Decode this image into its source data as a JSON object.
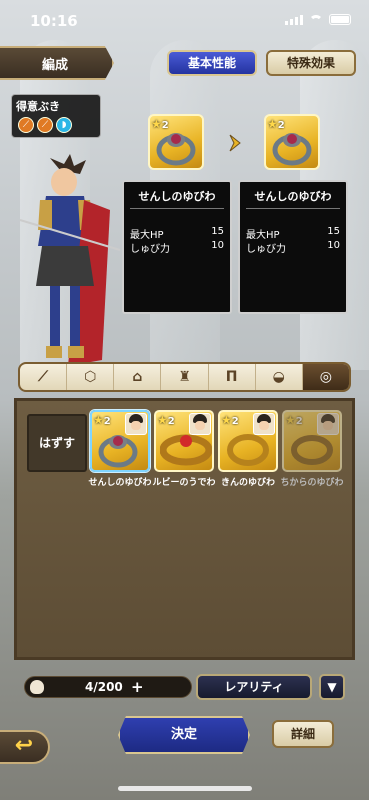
{
  "status_bar": {
    "time": "10:16"
  },
  "header": {
    "tab_label": "編成",
    "basic_label": "基本性能",
    "special_label": "特殊効果"
  },
  "weapon_panel": {
    "label": "得意ぶき"
  },
  "current": {
    "rarity": "2",
    "name": "せんしのゆびわ",
    "stat1_label": "最大HP",
    "stat1_value": "15",
    "stat2_label": "しゅび力",
    "stat2_value": "10"
  },
  "new": {
    "rarity": "2",
    "name": "せんしのゆびわ",
    "stat1_label": "最大HP",
    "stat1_value": "15",
    "stat2_label": "しゅび力",
    "stat2_value": "10"
  },
  "inventory": {
    "unequip_label": "はずす",
    "items": [
      {
        "rarity": "2",
        "name": "せんしのゆびわ"
      },
      {
        "rarity": "2",
        "name": "ルビーのうでわ"
      },
      {
        "rarity": "2",
        "name": "きんのゆびわ"
      },
      {
        "rarity": "2",
        "name": "ちからのゆびわ"
      }
    ]
  },
  "footer": {
    "count": "4/200",
    "plus": "+",
    "rarity_label": "レアリティ",
    "sort_icon": "▼",
    "confirm_label": "決定",
    "detail_label": "詳細",
    "back_icon": "↩"
  },
  "icons": [
    "sword-icon",
    "shield-icon",
    "helmet-icon",
    "armor-icon",
    "pants-icon",
    "accessory-icon",
    "ring-icon"
  ],
  "colors": {
    "accent_blue": "#2433a0",
    "gold": "#e8b324",
    "board": "#5d4d35"
  }
}
